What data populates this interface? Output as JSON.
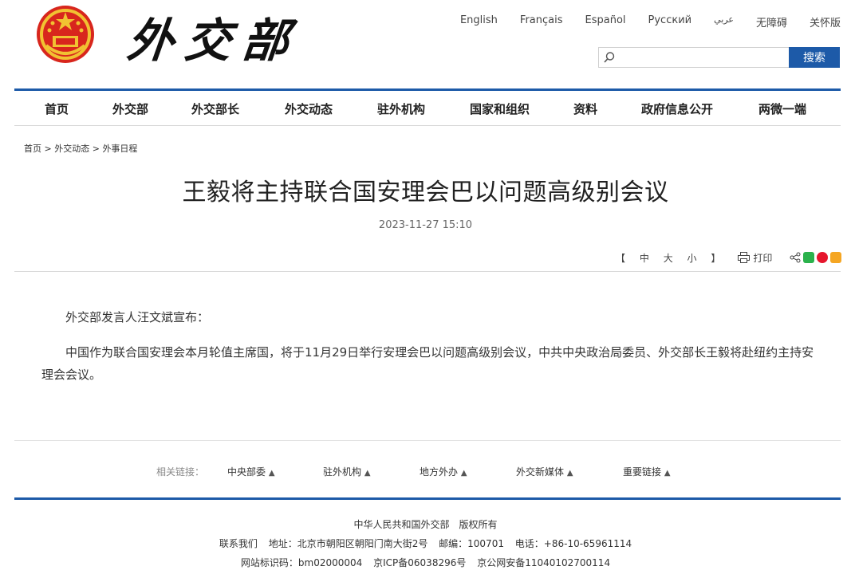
{
  "header": {
    "logo_text": "外交部",
    "languages": [
      "English",
      "Français",
      "Español",
      "Русский",
      "عربي",
      "无障碍",
      "关怀版"
    ],
    "search": {
      "placeholder": "",
      "button_label": "搜索"
    }
  },
  "nav": {
    "items": [
      "首页",
      "外交部",
      "外交部长",
      "外交动态",
      "驻外机构",
      "国家和组织",
      "资料",
      "政府信息公开",
      "两微一端"
    ]
  },
  "breadcrumb": {
    "items": [
      "首页",
      "外交动态",
      "外事日程"
    ],
    "separator": ">"
  },
  "article": {
    "title": "王毅将主持联合国安理会巴以问题高级别会议",
    "date": "2023-11-27 15:10",
    "font_size": {
      "open": "【",
      "large": "中",
      "medium": "大",
      "small": "小",
      "close": "】"
    },
    "print_label": "打印",
    "paragraphs": [
      "外交部发言人汪文斌宣布：",
      "中国作为联合国安理会本月轮值主席国，将于11月29日举行安理会巴以问题高级别会议，中共中央政治局委员、外交部长王毅将赴纽约主持安理会会议。"
    ]
  },
  "related_links": {
    "label": "相关链接：",
    "items": [
      "中央部委",
      "驻外机构",
      "地方外办",
      "外交新媒体",
      "重要链接"
    ]
  },
  "footer": {
    "copyright": "中华人民共和国外交部　版权所有",
    "contact_label": "联系我们",
    "address": "地址：北京市朝阳区朝阳门南大街2号",
    "postcode": "邮编：100701",
    "phone": "电话：+86-10-65961114",
    "site_id": "网站标识码：bm02000004",
    "icp": "京ICP备06038296号",
    "police": "京公网安备11040102700114"
  },
  "colors": {
    "accent": "#1d5aa8",
    "emblem_red": "#d8261d",
    "emblem_gold": "#f1c232"
  }
}
